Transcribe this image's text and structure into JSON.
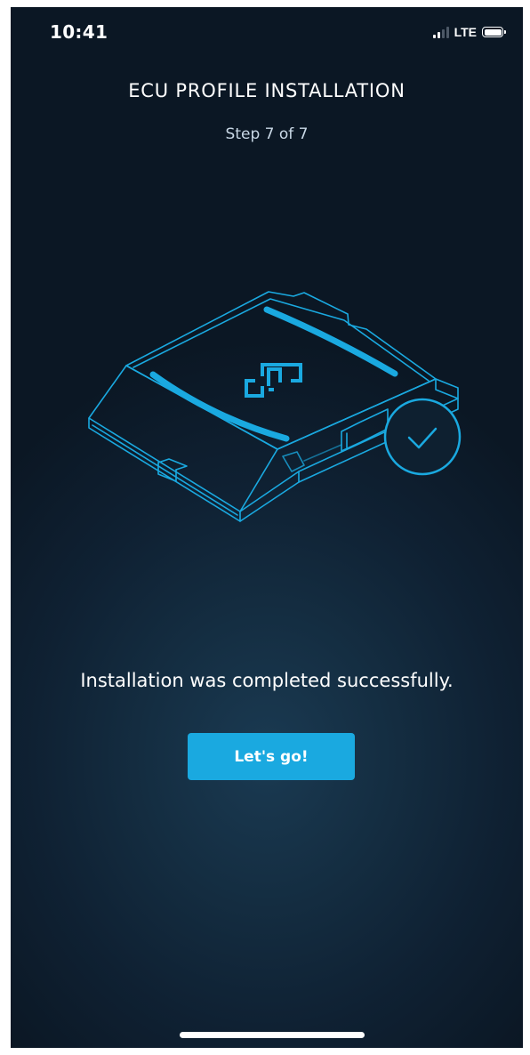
{
  "status_bar": {
    "time": "10:41",
    "network": "LTE",
    "signal_icon": "signal-bars-icon",
    "battery_icon": "battery-icon"
  },
  "header": {
    "title": "ECU PROFILE INSTALLATION",
    "step": "Step 7 of 7"
  },
  "illustration": {
    "device_icon": "ecu-device-icon",
    "logo_icon": "brand-logo-icon",
    "status_icon": "checkmark-circle-icon",
    "accent_color": "#1aa9e0"
  },
  "main": {
    "message": "Installation was completed successfully.",
    "button_label": "Let's go!"
  },
  "colors": {
    "background_dark": "#0b1724",
    "background_glow": "#1a3a52",
    "button": "#1aa9e0",
    "text": "#ffffff"
  }
}
